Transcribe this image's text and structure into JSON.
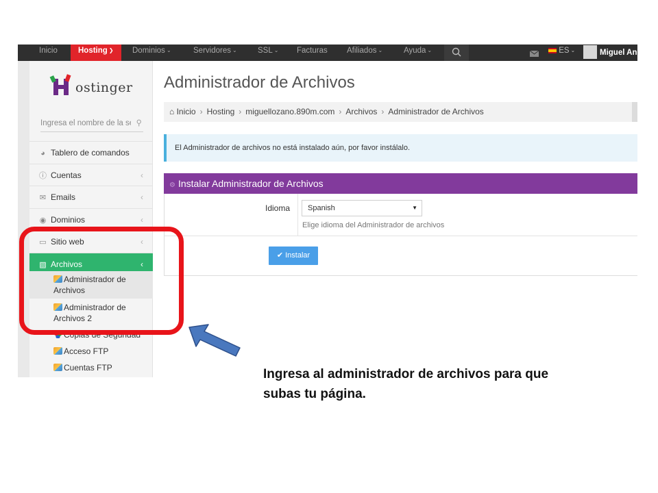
{
  "topbar": {
    "nav": [
      "Inicio",
      "Hosting",
      "Dominios",
      "Servidores",
      "SSL",
      "Facturas",
      "Afiliados",
      "Ayuda"
    ],
    "language": "ES",
    "user": "Miguel Ang"
  },
  "sidebar": {
    "logo_text": "ostinger",
    "search_placeholder": "Ingresa el nombre de la sección",
    "items": [
      "Tablero de comandos",
      "Cuentas",
      "Emails",
      "Dominios",
      "Sitio web",
      "Archivos"
    ],
    "subitems": [
      "Administrador de Archivos",
      "Administrador de Archivos 2",
      "Copias de Seguridad",
      "Acceso FTP",
      "Cuentas FTP"
    ]
  },
  "main": {
    "title": "Administrador de Archivos",
    "breadcrumb": [
      "Inicio",
      "Hosting",
      "miguellozano.890m.com",
      "Archivos",
      "Administrador de Archivos"
    ],
    "alert": "El Administrador de archivos no está instalado aún, por favor instálalo.",
    "panel_title": "Instalar Administrador de Archivos",
    "language_label": "Idioma",
    "language_value": "Spanish",
    "language_help": "Elige idioma del Administrador de archivos",
    "install_label": "Instalar"
  },
  "colors": {
    "active_nav": "#e1242a",
    "active_menu": "#2fb46e",
    "panel_header": "#823a9c",
    "button": "#4a9fe8",
    "highlight_box": "#e8141a",
    "arrow": "#4a78be"
  },
  "caption": {
    "line1": "Ingresa al administrador de archivos para que",
    "line2": "subas tu página."
  }
}
